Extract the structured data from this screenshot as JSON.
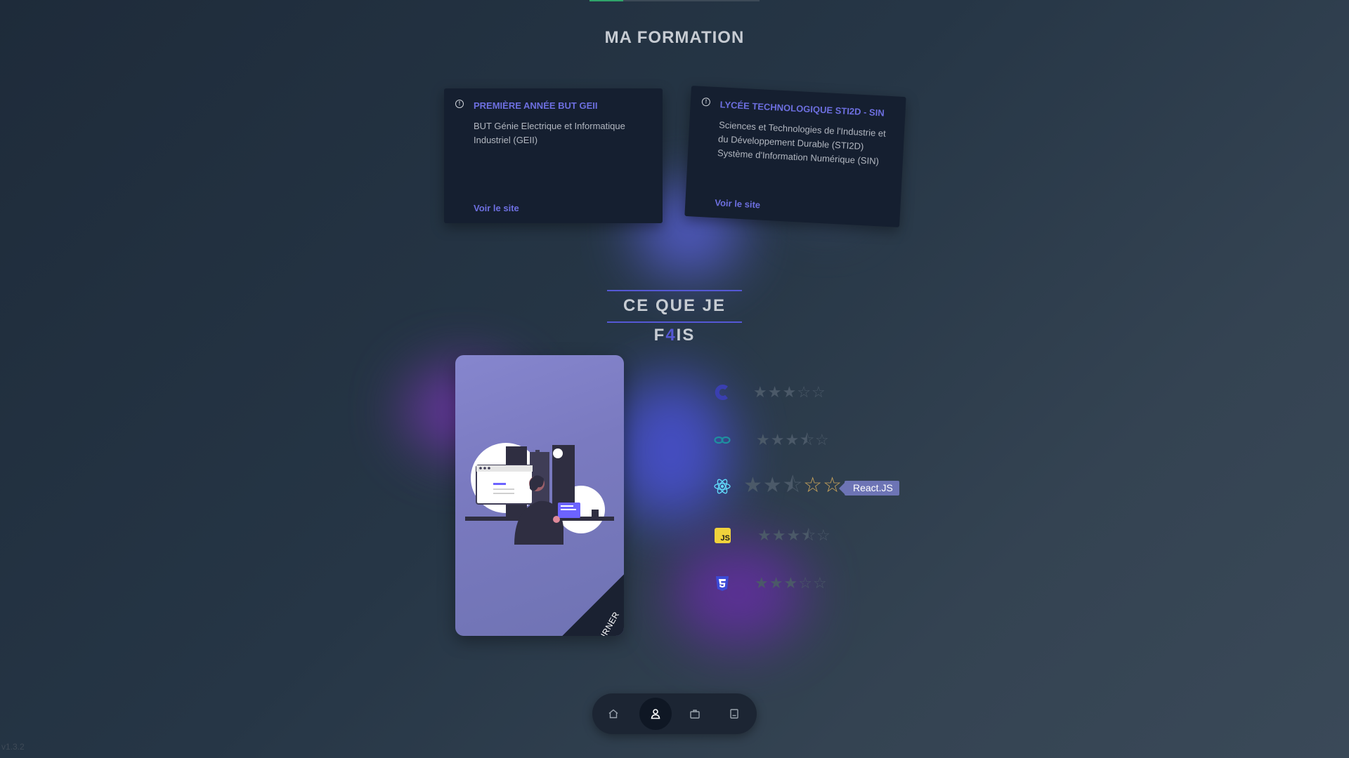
{
  "progress": {
    "value": 0.2
  },
  "formation": {
    "title": "MA FORMATION",
    "cards": [
      {
        "title": "PREMIÈRE ANNÉE BUT GEII",
        "description": "BUT Génie Electrique et Informatique Industriel (GEII)",
        "link": "Voir le site"
      },
      {
        "title": "LYCÉE TECHNOLOGIQUE STI2D - SIN",
        "description": "Sciences et Technologies de l'Industrie et du Développement Durable (STI2D)\nSystème d'Information Numérique (SIN)",
        "link": "Voir le site"
      }
    ]
  },
  "skills_section": {
    "title_before": "CE QUE JE F",
    "title_accent": "4",
    "title_after": "IS",
    "flip_card_label": "RETOURNER",
    "skills": [
      {
        "icon": "c-language-icon",
        "rating": 3,
        "max": 5,
        "color": "#3a3fb0"
      },
      {
        "icon": "arduino-icon",
        "rating": 3.5,
        "max": 5,
        "color": "#1f8fa0"
      },
      {
        "icon": "react-icon",
        "rating": 2.5,
        "max": 5,
        "color": "#61dafb",
        "tooltip": "React.JS"
      },
      {
        "icon": "javascript-icon",
        "rating": 3.5,
        "max": 5,
        "color": "#f0d23c",
        "badge": "JS"
      },
      {
        "icon": "css3-icon",
        "rating": 3,
        "max": 5,
        "color": "#3c4ad6"
      }
    ]
  },
  "nav": {
    "items": [
      {
        "name": "home-icon"
      },
      {
        "name": "user-icon",
        "active": true
      },
      {
        "name": "briefcase-icon"
      },
      {
        "name": "book-icon"
      }
    ]
  },
  "version": "v1.3.2",
  "colors": {
    "accent": "#5558d6",
    "link": "#6d6fe0",
    "star": "#d8a954"
  }
}
